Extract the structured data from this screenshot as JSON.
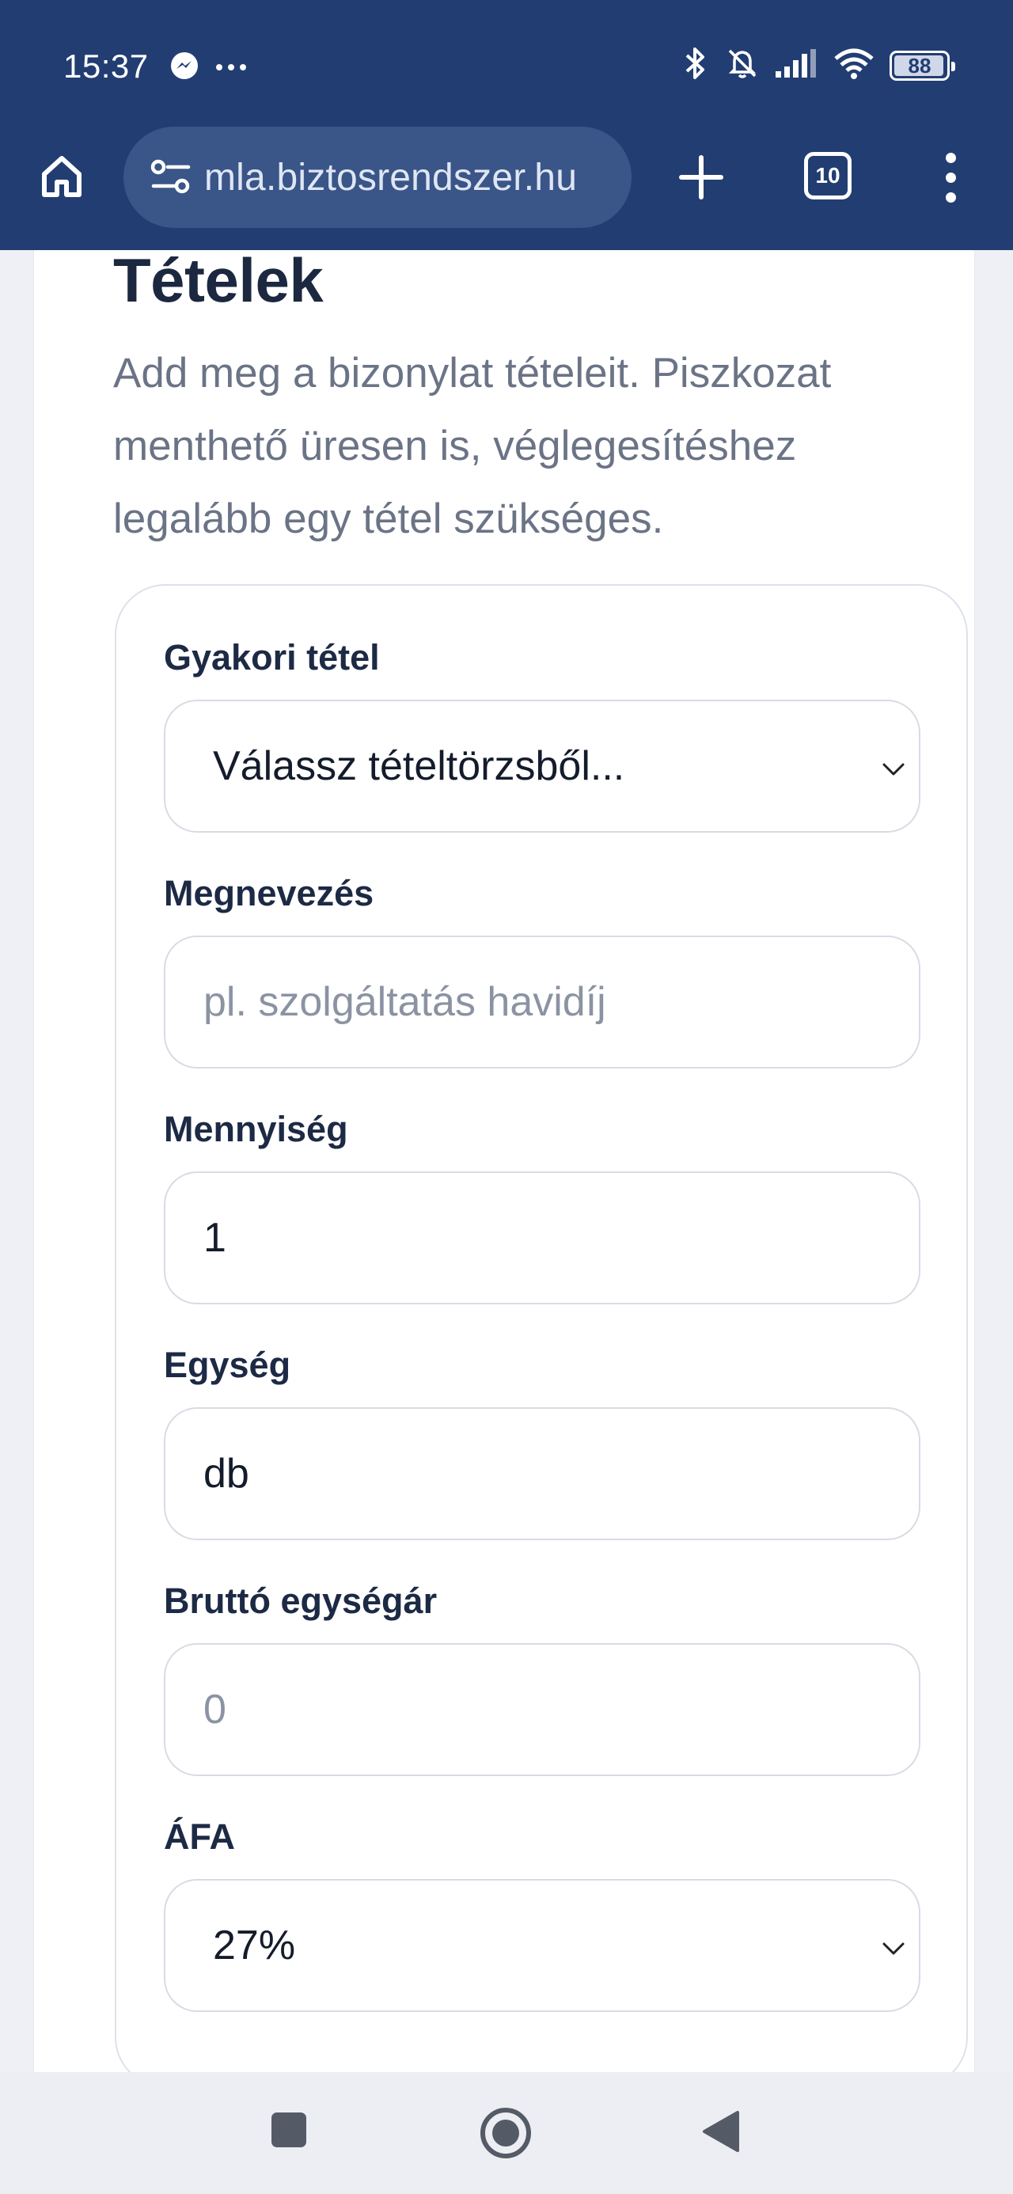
{
  "status_bar": {
    "time": "15:37",
    "battery": "88",
    "battery_level": 0.88,
    "icons": [
      "messenger-icon",
      "more-icon",
      "bluetooth-icon",
      "mute-icon",
      "signal-icon",
      "wifi-icon",
      "battery-icon"
    ]
  },
  "browser": {
    "url": "mla.biztosrendszer.hu",
    "tab_count": "10"
  },
  "section": {
    "title": "Tételek",
    "description": "Add meg a bizonylat tételeit. Piszkozat menthető üresen is, véglegesítéshez legalább egy tétel szükséges."
  },
  "form": {
    "frequent_item": {
      "label": "Gyakori tétel",
      "value": "Válassz tételtörzsből..."
    },
    "name": {
      "label": "Megnevezés",
      "placeholder": "pl. szolgáltatás havidíj",
      "value": ""
    },
    "quantity": {
      "label": "Mennyiség",
      "value": "1"
    },
    "unit": {
      "label": "Egység",
      "value": "db"
    },
    "gross_unit_price": {
      "label": "Bruttó egységár",
      "placeholder": "0",
      "value": ""
    },
    "vat": {
      "label": "ÁFA",
      "value": "27%"
    }
  },
  "colors": {
    "chrome": "#223d72",
    "url_box": "#3a5588",
    "title": "#1c2740",
    "muted_text": "#6b7486",
    "border": "#d7dce4"
  }
}
